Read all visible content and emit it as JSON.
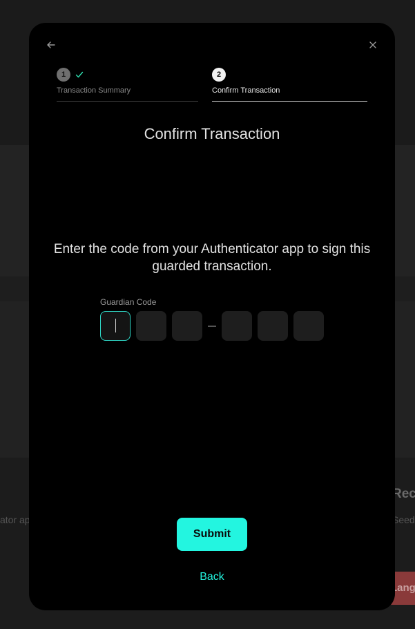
{
  "background": {
    "left_text": "ator ap",
    "right_heading": "Rec",
    "right_text": "Seed",
    "right_button": "Langua"
  },
  "modal": {
    "back_icon": "arrow-left-icon",
    "close_icon": "close-icon",
    "steps": [
      {
        "number": "1",
        "label": "Transaction Summary",
        "completed": true,
        "check_icon": "check-icon"
      },
      {
        "number": "2",
        "label": "Confirm Transaction",
        "active": true
      }
    ],
    "title": "Confirm Transaction",
    "instruction": "Enter the code from your Authenticator app to sign this guarded transaction.",
    "code_field": {
      "label": "Guardian Code",
      "digits": [
        "",
        "",
        "",
        "",
        "",
        ""
      ]
    },
    "submit_label": "Submit",
    "back_label": "Back"
  },
  "colors": {
    "accent": "#23F5E0",
    "modal_bg": "#000000",
    "input_bg": "#1E1E1E",
    "step_done": "#6F6F6F"
  }
}
